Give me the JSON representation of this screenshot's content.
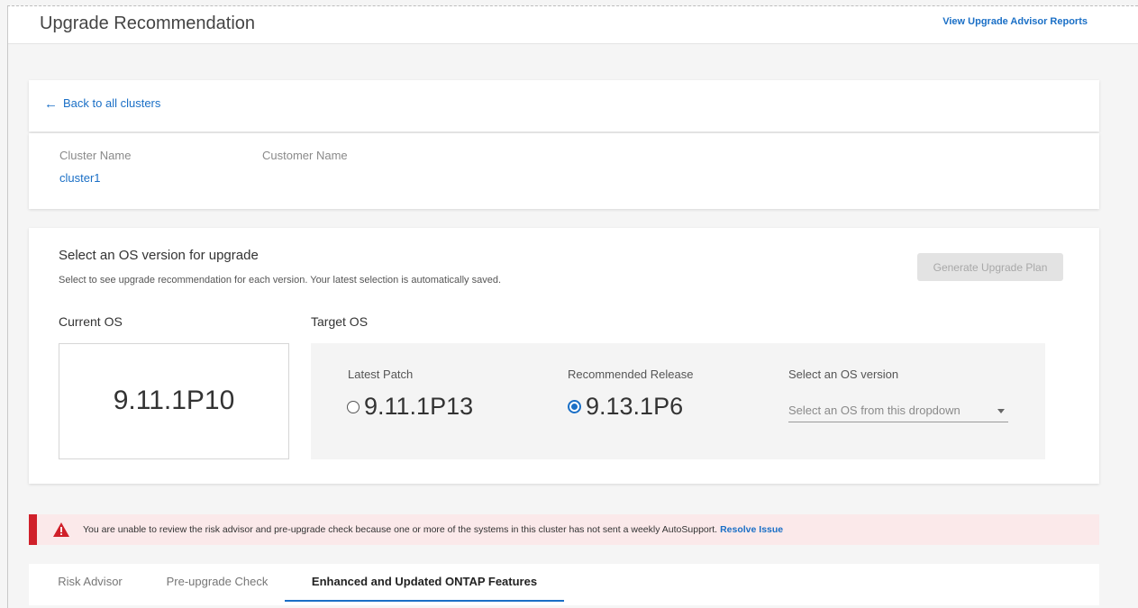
{
  "header": {
    "title": "Upgrade Recommendation",
    "reports_link": "View Upgrade Advisor Reports"
  },
  "back": {
    "label": "Back to all clusters"
  },
  "cluster": {
    "cluster_name_label": "Cluster Name",
    "cluster_name_value": "cluster1",
    "customer_name_label": "Customer Name",
    "customer_name_value": ""
  },
  "os_select": {
    "title": "Select an OS version for upgrade",
    "subtitle": "Select to see upgrade recommendation for each version. Your latest selection is automatically saved.",
    "generate_button": "Generate Upgrade Plan",
    "current_label": "Current OS",
    "current_version": "9.11.1P10",
    "target_label": "Target OS",
    "latest_patch_label": "Latest Patch",
    "latest_patch_value": "9.11.1P13",
    "recommended_label": "Recommended Release",
    "recommended_value": "9.13.1P6",
    "select_version_label": "Select an OS version",
    "dropdown_placeholder": "Select an OS from this dropdown"
  },
  "warning": {
    "message": "You are unable to review the risk advisor and pre-upgrade check because one or more of the systems in this cluster has not sent a weekly AutoSupport.",
    "link": "Resolve Issue",
    "color": "#d0202a"
  },
  "tabs": [
    {
      "label": "Risk Advisor"
    },
    {
      "label": "Pre-upgrade Check"
    },
    {
      "label": "Enhanced and Updated ONTAP Features"
    }
  ],
  "colors": {
    "accent": "#1a6fc6",
    "warning_bg": "#fbe9ea"
  }
}
